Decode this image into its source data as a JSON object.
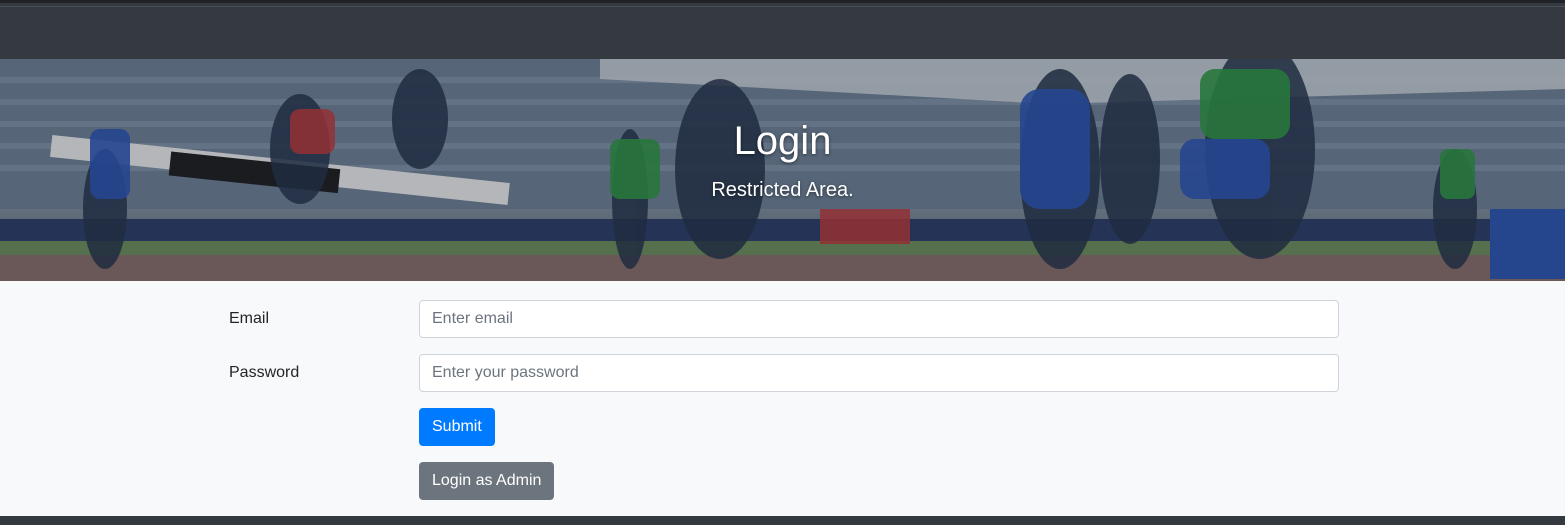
{
  "hero": {
    "title": "Login",
    "subtitle": "Restricted Area."
  },
  "form": {
    "email": {
      "label": "Email",
      "placeholder": "Enter email",
      "value": ""
    },
    "password": {
      "label": "Password",
      "placeholder": "Enter your password",
      "value": ""
    },
    "submit_label": "Submit",
    "admin_login_label": "Login as Admin"
  },
  "colors": {
    "navbar": "#343a40",
    "primary": "#007bff",
    "secondary": "#6c757d",
    "page_background": "#f8f9fa"
  }
}
